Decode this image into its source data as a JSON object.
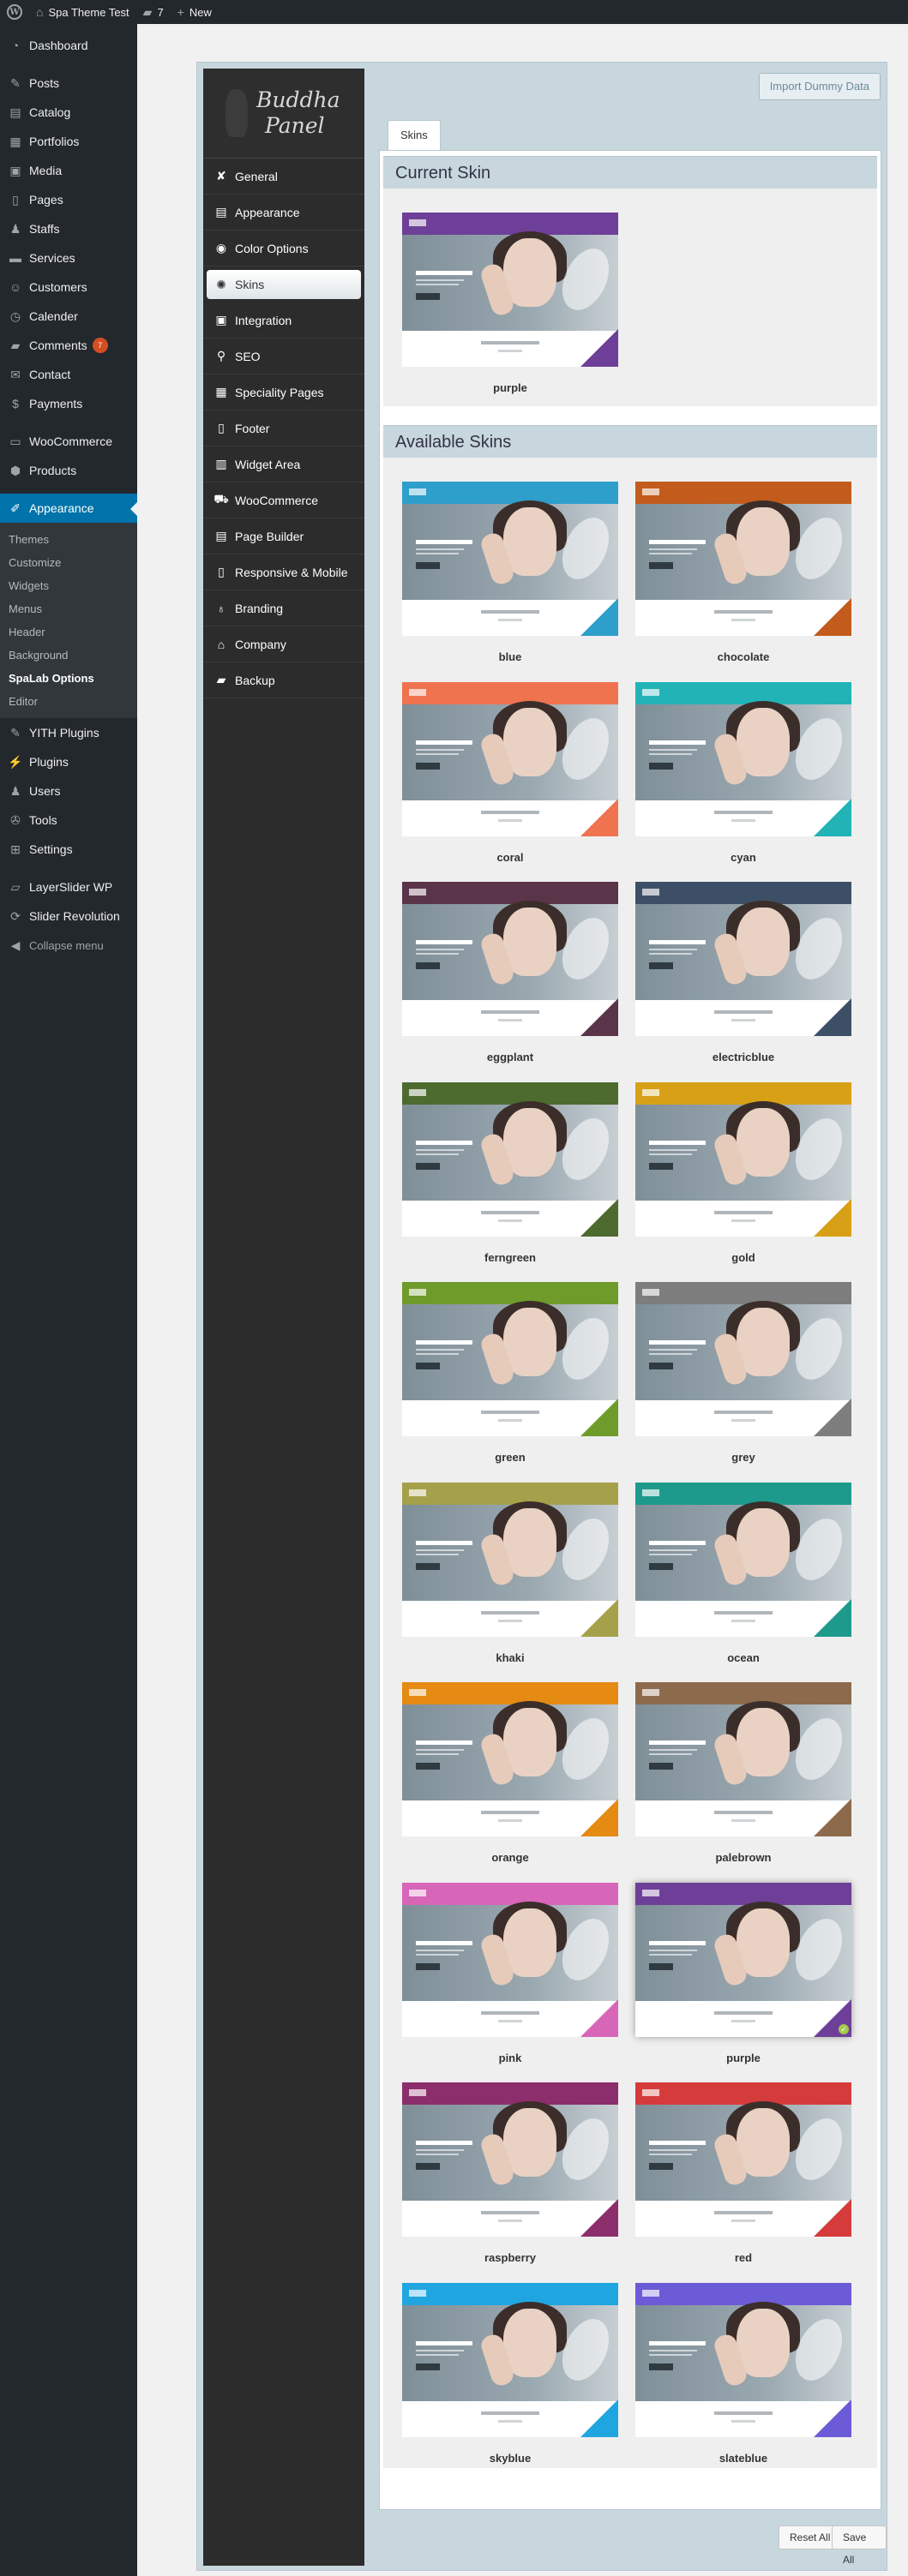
{
  "adminbar": {
    "site_name": "Spa Theme Test",
    "comments_count": "7",
    "new_label": "New"
  },
  "admin_menu": {
    "items": [
      {
        "label": "Dashboard",
        "icon": "dashboard-icon"
      },
      {
        "label": "Posts",
        "icon": "pin-icon"
      },
      {
        "label": "Catalog",
        "icon": "catalog-icon"
      },
      {
        "label": "Portfolios",
        "icon": "portfolio-icon"
      },
      {
        "label": "Media",
        "icon": "media-icon"
      },
      {
        "label": "Pages",
        "icon": "pages-icon"
      },
      {
        "label": "Staffs",
        "icon": "staff-icon"
      },
      {
        "label": "Services",
        "icon": "services-icon"
      },
      {
        "label": "Customers",
        "icon": "customers-icon"
      },
      {
        "label": "Calender",
        "icon": "calendar-icon"
      },
      {
        "label": "Comments",
        "icon": "comments-icon",
        "badge": "7"
      },
      {
        "label": "Contact",
        "icon": "contact-icon"
      },
      {
        "label": "Payments",
        "icon": "payments-icon"
      },
      {
        "label": "WooCommerce",
        "icon": "woocommerce-icon"
      },
      {
        "label": "Products",
        "icon": "products-icon"
      },
      {
        "label": "Appearance",
        "icon": "paintbrush-icon"
      },
      {
        "label": "YITH Plugins",
        "icon": "yith-icon"
      },
      {
        "label": "Plugins",
        "icon": "plugins-icon"
      },
      {
        "label": "Users",
        "icon": "users-icon"
      },
      {
        "label": "Tools",
        "icon": "tools-icon"
      },
      {
        "label": "Settings",
        "icon": "settings-icon"
      },
      {
        "label": "LayerSlider WP",
        "icon": "layerslider-icon"
      },
      {
        "label": "Slider Revolution",
        "icon": "slider-revolution-icon"
      },
      {
        "label": "Collapse menu",
        "icon": "collapse-icon"
      }
    ],
    "appearance_submenu": [
      "Themes",
      "Customize",
      "Widgets",
      "Menus",
      "Header",
      "Background",
      "SpaLab Options",
      "Editor"
    ]
  },
  "panel": {
    "logo_text": [
      "Buddha",
      "Panel"
    ],
    "import_button": "Import Dummy Data",
    "tab_label": "Skins",
    "nav": [
      {
        "label": "General",
        "icon": "tools-icon"
      },
      {
        "label": "Appearance",
        "icon": "appearance-icon"
      },
      {
        "label": "Color Options",
        "icon": "eye-icon"
      },
      {
        "label": "Skins",
        "icon": "gear-icon"
      },
      {
        "label": "Integration",
        "icon": "integration-icon"
      },
      {
        "label": "SEO",
        "icon": "search-icon"
      },
      {
        "label": "Speciality Pages",
        "icon": "grid-icon"
      },
      {
        "label": "Footer",
        "icon": "footer-icon"
      },
      {
        "label": "Widget Area",
        "icon": "widget-icon"
      },
      {
        "label": "WooCommerce",
        "icon": "cart-icon"
      },
      {
        "label": "Page Builder",
        "icon": "page-builder-icon"
      },
      {
        "label": "Responsive & Mobile",
        "icon": "mobile-icon"
      },
      {
        "label": "Branding",
        "icon": "bulb-icon"
      },
      {
        "label": "Company",
        "icon": "bank-icon"
      },
      {
        "label": "Backup",
        "icon": "briefcase-icon"
      }
    ],
    "current_skin_title": "Current Skin",
    "current_skin": {
      "name": "purple",
      "color": "#6e3f98"
    },
    "available_skins_title": "Available Skins",
    "skins": [
      {
        "name": "blue",
        "color": "#2e9ecb"
      },
      {
        "name": "chocolate",
        "color": "#c25b1c"
      },
      {
        "name": "coral",
        "color": "#f0734f"
      },
      {
        "name": "cyan",
        "color": "#22b3b7"
      },
      {
        "name": "eggplant",
        "color": "#5a3448"
      },
      {
        "name": "electricblue",
        "color": "#3c4f66"
      },
      {
        "name": "ferngreen",
        "color": "#4d6b2f"
      },
      {
        "name": "gold",
        "color": "#d8a017"
      },
      {
        "name": "green",
        "color": "#6f9b2a"
      },
      {
        "name": "grey",
        "color": "#7d7d7d"
      },
      {
        "name": "khaki",
        "color": "#a5a14b"
      },
      {
        "name": "ocean",
        "color": "#1e9a8c"
      },
      {
        "name": "orange",
        "color": "#e58a13"
      },
      {
        "name": "palebrown",
        "color": "#8d6a4c"
      },
      {
        "name": "pink",
        "color": "#d766b8"
      },
      {
        "name": "purple",
        "color": "#6e3f98",
        "selected": true
      },
      {
        "name": "raspberry",
        "color": "#8c2e6b"
      },
      {
        "name": "red",
        "color": "#d63b3b"
      },
      {
        "name": "skyblue",
        "color": "#1fa6e0"
      },
      {
        "name": "slateblue",
        "color": "#6c5bd6"
      }
    ],
    "reset_button": "Reset All",
    "save_button": "Save All"
  }
}
